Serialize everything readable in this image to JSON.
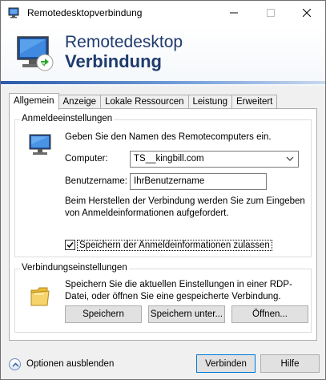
{
  "window": {
    "title": "Remotedesktopverbindung",
    "minimize_icon": "minimize-icon",
    "maximize_icon": "maximize-icon",
    "close_icon": "close-icon"
  },
  "banner": {
    "line1": "Remotedesktop",
    "line2": "Verbindung",
    "icon": "remote-desktop-icon",
    "title_color": "#1f3a6e"
  },
  "tabs": [
    {
      "label": "Allgemein",
      "active": true
    },
    {
      "label": "Anzeige",
      "active": false
    },
    {
      "label": "Lokale Ressourcen",
      "active": false
    },
    {
      "label": "Leistung",
      "active": false
    },
    {
      "label": "Erweitert",
      "active": false
    }
  ],
  "login_group": {
    "legend": "Anmeldeeinstellungen",
    "description": "Geben Sie den Namen des Remotecomputers ein.",
    "computer_label": "Computer:",
    "computer_value": "TS__kingbill.com",
    "username_label": "Benutzername:",
    "username_value": "IhrBenutzername",
    "info_text": "Beim Herstellen der Verbindung werden Sie zum Eingeben von Anmeldeinformationen aufgefordert.",
    "save_credentials_label": "Speichern der Anmeldeinformationen zulassen",
    "save_credentials_checked": true
  },
  "connection_group": {
    "legend": "Verbindungseinstellungen",
    "description": "Speichern Sie die aktuellen Einstellungen in einer RDP-Datei, oder öffnen Sie eine gespeicherte Verbindung.",
    "save_label": "Speichern",
    "save_as_label": "Speichern unter...",
    "open_label": "Öffnen..."
  },
  "footer": {
    "options_label": "Optionen ausblenden",
    "connect_label": "Verbinden",
    "help_label": "Hilfe"
  },
  "colors": {
    "accent": "#0078d7",
    "banner_text": "#1f3a6e",
    "stripe": "#2a5aa8"
  }
}
